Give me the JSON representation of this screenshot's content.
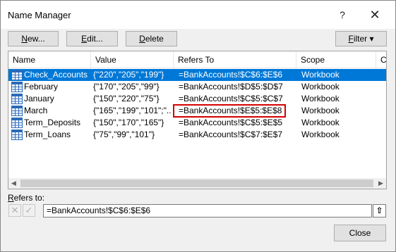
{
  "window": {
    "title": "Name Manager",
    "help_glyph": "?",
    "close_glyph": "✕"
  },
  "toolbar": {
    "new_key": "N",
    "new_rest": "ew...",
    "edit_key": "E",
    "edit_rest": "dit...",
    "delete_key": "D",
    "delete_rest": "elete",
    "filter_key": "F",
    "filter_rest": "ilter",
    "filter_arrow": "▾"
  },
  "list": {
    "columns": [
      "Name",
      "Value",
      "Refers To",
      "Scope",
      "C"
    ],
    "rows": [
      {
        "name": "Check_Accounts",
        "value": "{\"220\",\"205\",\"199\"}",
        "refers_to": "=BankAccounts!$C$6:$E$6",
        "scope": "Workbook",
        "selected": true
      },
      {
        "name": "February",
        "value": "{\"170\",\"205\",\"99\"}",
        "refers_to": "=BankAccounts!$D$5:$D$7",
        "scope": "Workbook",
        "selected": false
      },
      {
        "name": "January",
        "value": "{\"150\",\"220\",\"75\"}",
        "refers_to": "=BankAccounts!$C$5:$C$7",
        "scope": "Workbook",
        "selected": false
      },
      {
        "name": "March",
        "value": "{\"165\",\"199\",\"101\";\"...",
        "refers_to": "=BankAccounts!$E$5:$E$8",
        "scope": "Workbook",
        "selected": false,
        "highlighted": true
      },
      {
        "name": "Term_Deposits",
        "value": "{\"150\",\"170\",\"165\"}",
        "refers_to": "=BankAccounts!$C$5:$E$5",
        "scope": "Workbook",
        "selected": false
      },
      {
        "name": "Term_Loans",
        "value": "{\"75\",\"99\",\"101\"}",
        "refers_to": "=BankAccounts!$C$7:$E$7",
        "scope": "Workbook",
        "selected": false
      }
    ]
  },
  "refers": {
    "label_key": "R",
    "label_rest": "efers to:",
    "value": "=BankAccounts!$C$6:$E$6",
    "cancel_glyph": "✕",
    "ok_glyph": "✓",
    "collapse_glyph": "⇧"
  },
  "footer": {
    "close_label": "Close"
  },
  "colors": {
    "selection": "#0078d7",
    "highlight_box": "#d40000"
  }
}
